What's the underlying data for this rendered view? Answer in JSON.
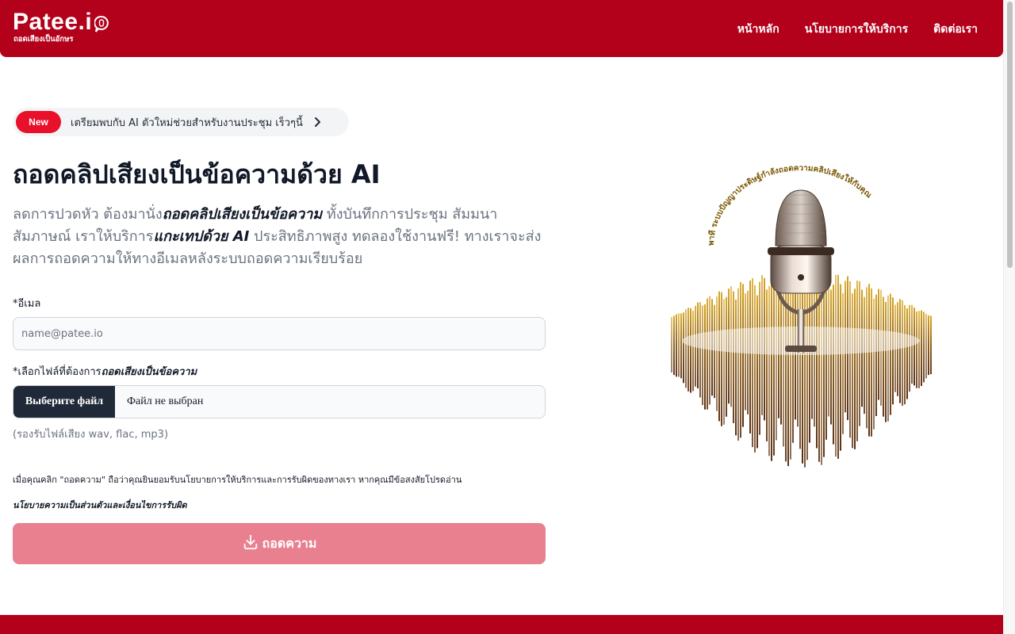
{
  "brand": {
    "name": "Patee.i",
    "tagline": "ถอดเสียงเป็นอักษร"
  },
  "nav": {
    "items": [
      {
        "label": "หน้าหลัก"
      },
      {
        "label": "นโยบายการให้บริการ"
      },
      {
        "label": "ติดต่อเรา"
      }
    ]
  },
  "announcement": {
    "badge": "New",
    "text": "เตรียมพบกับ AI ตัวใหม่ช่วยสำหรับงานประชุม เร็วๆนี้"
  },
  "hero": {
    "title": "ถอดคลิปเสียงเป็นข้อความด้วย AI",
    "lead": {
      "p1": "ลดการปวดหัว ต้องมานั่ง",
      "b1": "ถอดคลิปเสียงเป็นข้อความ",
      "p2": " ทั้งบันทึกการประชุม สัมมนา สัมภาษณ์ เราให้บริการ",
      "b2": "แกะเทปด้วย AI",
      "p3": " ประสิทธิภาพสูง ทดลองใช้งานฟรี! ทางเราจะส่งผลการถอดความให้ทางอีเมลหลังระบบถอดความเรียบร้อย"
    },
    "image_text": "พาที ระบบปัญญาประดิษฐ์กำลังถอดความคลิปเสียงให้กับคุณ"
  },
  "form": {
    "email_label": "*อีเมล",
    "email_placeholder": "name@patee.io",
    "email_value": "",
    "file_label_prefix": "*เลือกไฟล์ที่ต้องการ",
    "file_label_bold": "ถอดเสียงเป็นข้อความ",
    "file_button": "Выберите файл",
    "file_status": "Файл не выбран",
    "file_hint": "(รองรับไฟล์เสียง wav, flac, mp3)",
    "terms_text": "เมื่อคุณคลิก \"ถอดความ\" ถือว่าคุณยินยอมรับนโยบายการให้บริการและการรับผิดของทางเรา หากคุณมีข้อสงสัยโปรดอ่าน",
    "terms_link": "นโยบายความเป็นส่วนตัวและเงื่อนไขการรับผิด",
    "submit_label": "ถอดความ",
    "submit_icon": "download-icon"
  },
  "colors": {
    "brand": "#b3001b",
    "badge": "#e8102b",
    "button_disabled": "#e88090"
  }
}
